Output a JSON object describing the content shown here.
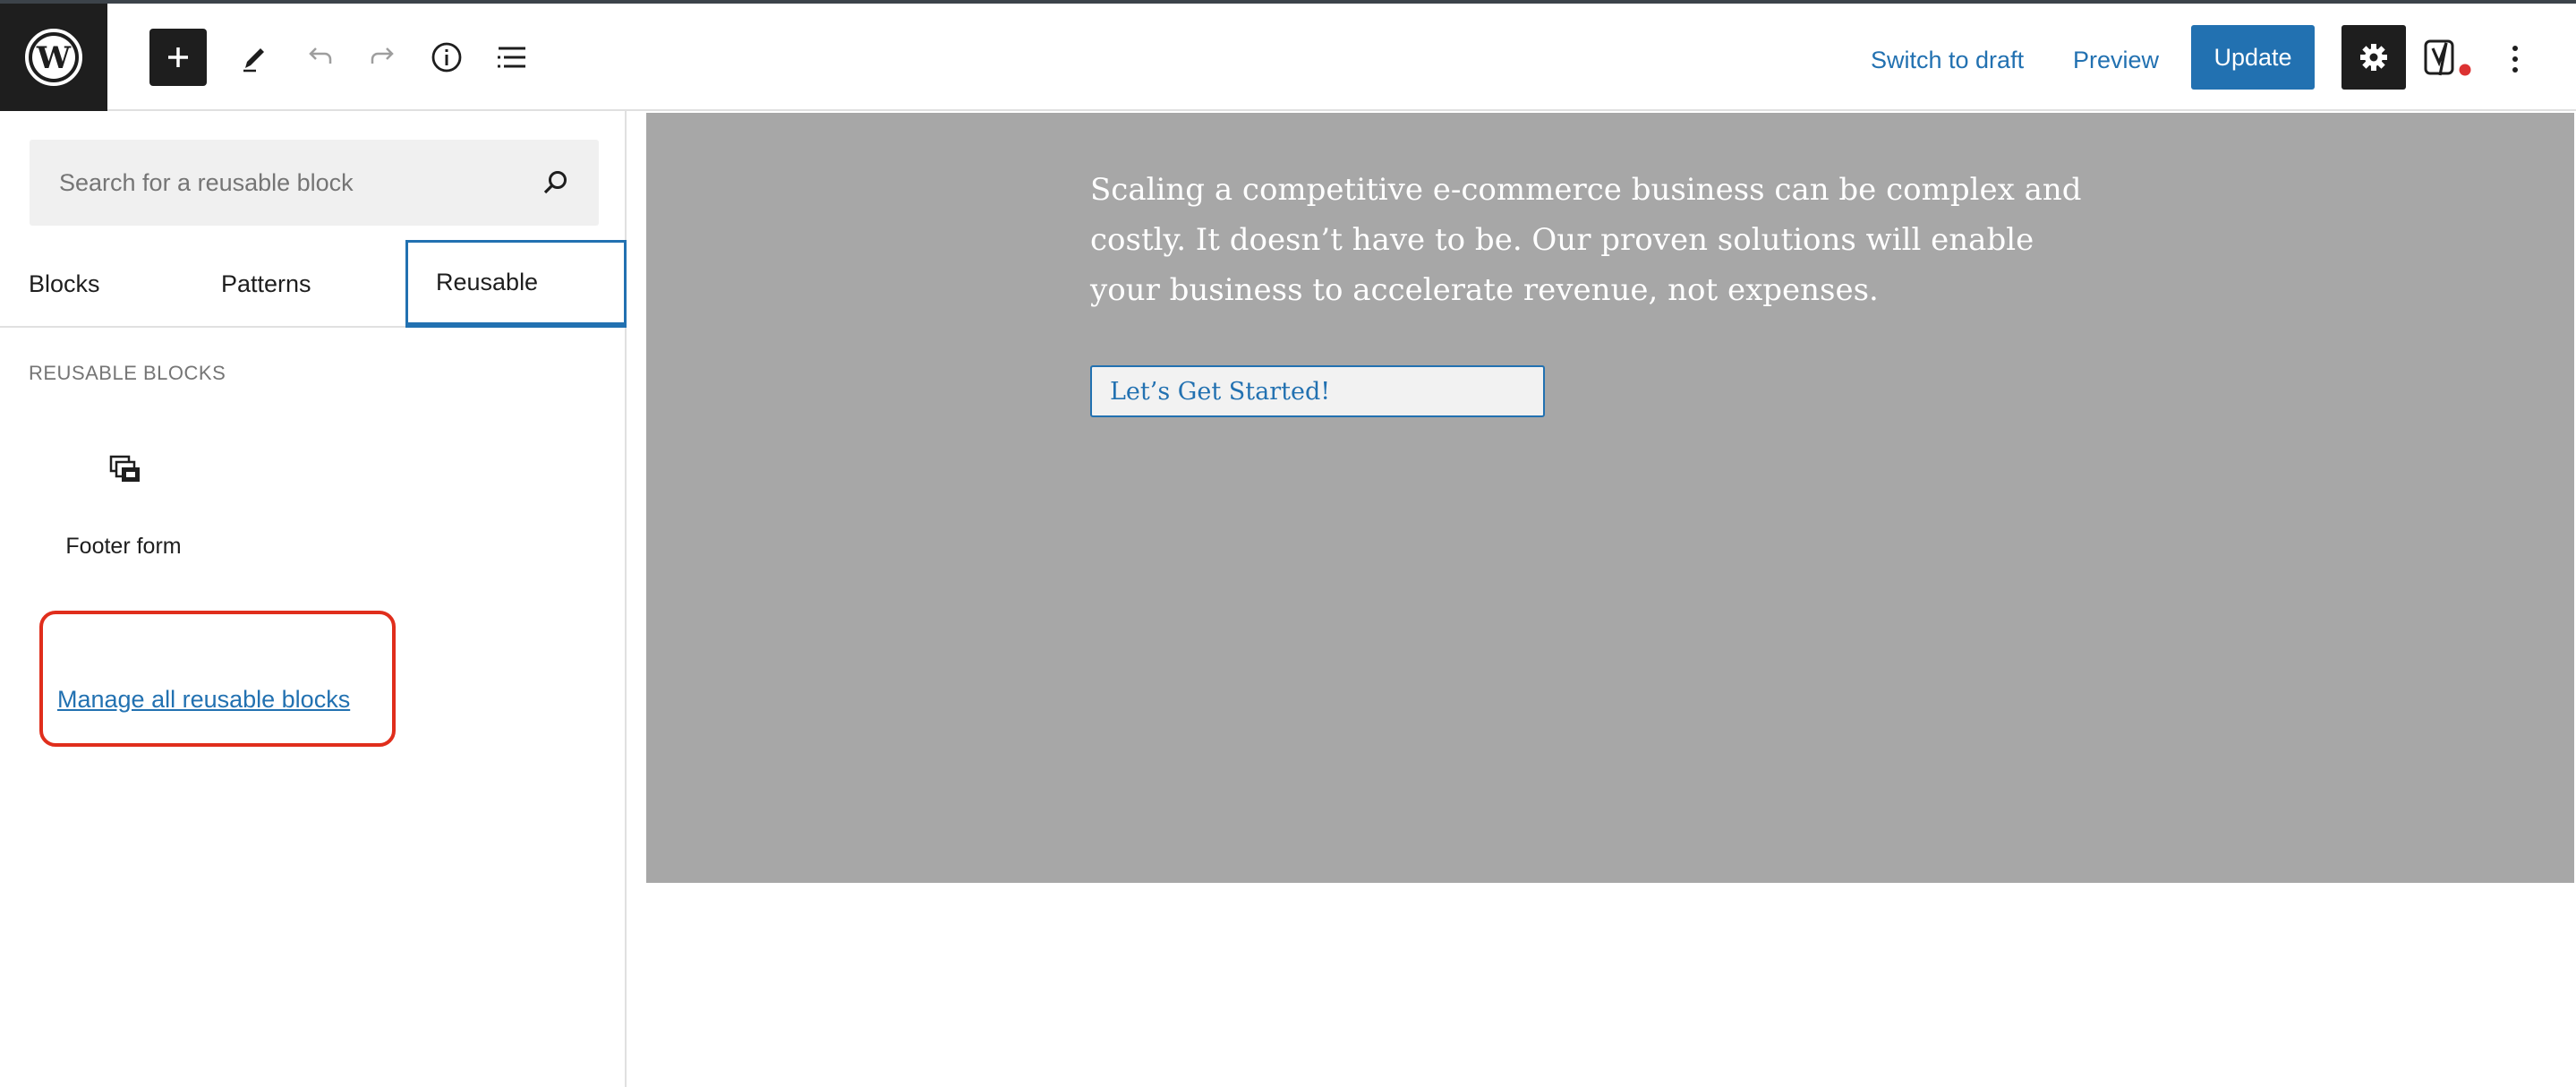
{
  "header": {
    "switch_to_draft": "Switch to draft",
    "preview": "Preview",
    "update": "Update",
    "icons": [
      "wordpress-logo",
      "plus-icon",
      "pencil-icon",
      "undo-icon",
      "redo-icon",
      "info-icon",
      "list-view-icon",
      "gear-icon",
      "yoast-icon",
      "more-vertical-icon"
    ]
  },
  "sidebar": {
    "search": {
      "placeholder": "Search for a reusable block",
      "value": ""
    },
    "tabs": [
      {
        "label": "Blocks"
      },
      {
        "label": "Patterns"
      },
      {
        "label": "Reusable",
        "active": true
      }
    ],
    "section_title": "Reusable blocks",
    "blocks": [
      {
        "label": "Footer form",
        "icon": "reusable-block-icon"
      }
    ],
    "manage_link": "Manage all reusable blocks"
  },
  "canvas": {
    "hero_text": "Scaling a competitive e-commerce business can be complex and costly. It doesn’t have to be. Our proven solutions will enable your business to accelerate revenue, not expenses.",
    "cta_button": "Let’s Get Started!"
  },
  "colors": {
    "accent": "#2271b1",
    "highlight": "#e02e1c",
    "canvas_bg": "#a7a7a7",
    "yoast_dot": "#dc3232"
  }
}
